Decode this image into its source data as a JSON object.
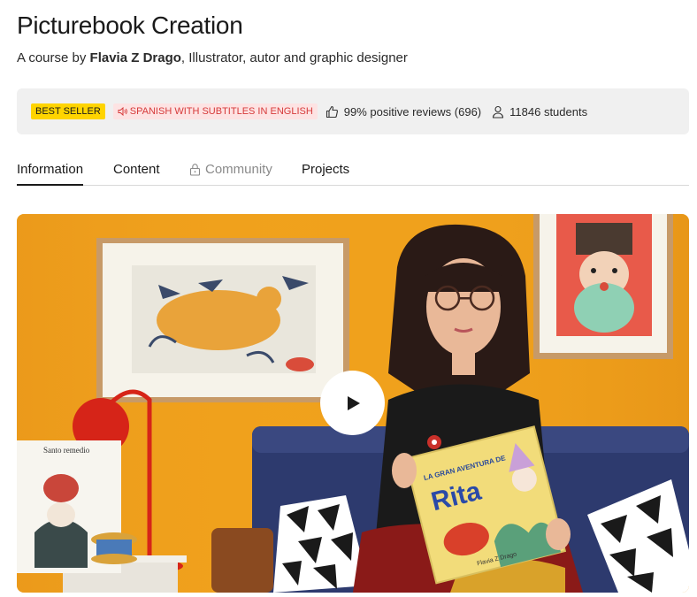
{
  "course": {
    "title": "Picturebook Creation",
    "byline_prefix": "A course by ",
    "author": "Flavia Z Drago",
    "author_role": ", Illustrator, autor and graphic designer"
  },
  "stats": {
    "best_seller": "BEST SELLER",
    "language": "SPANISH WITH SUBTITLES IN ENGLISH",
    "reviews": "99% positive reviews (696)",
    "students": "11846 students"
  },
  "tabs": [
    {
      "label": "Information",
      "active": true
    },
    {
      "label": "Content",
      "active": false
    },
    {
      "label": "Community",
      "locked": true
    },
    {
      "label": "Projects",
      "active": false
    }
  ],
  "video": {
    "book_title_top": "LA GRAN AVENTURA DE",
    "book_title": "Rita",
    "book_author": "Flavia Z Drago",
    "left_book_title": "Santo remedio"
  },
  "colors": {
    "best_seller_bg": "#ffd400",
    "language_text": "#d63a3a",
    "language_bg": "#fde3e3",
    "stats_bg": "#f0f0f0",
    "video_wall": "#f0a11c"
  },
  "icons": {
    "language": "speaker-icon",
    "reviews": "thumbs-up-icon",
    "students": "user-icon",
    "locked": "lock-icon",
    "play": "play-icon"
  }
}
